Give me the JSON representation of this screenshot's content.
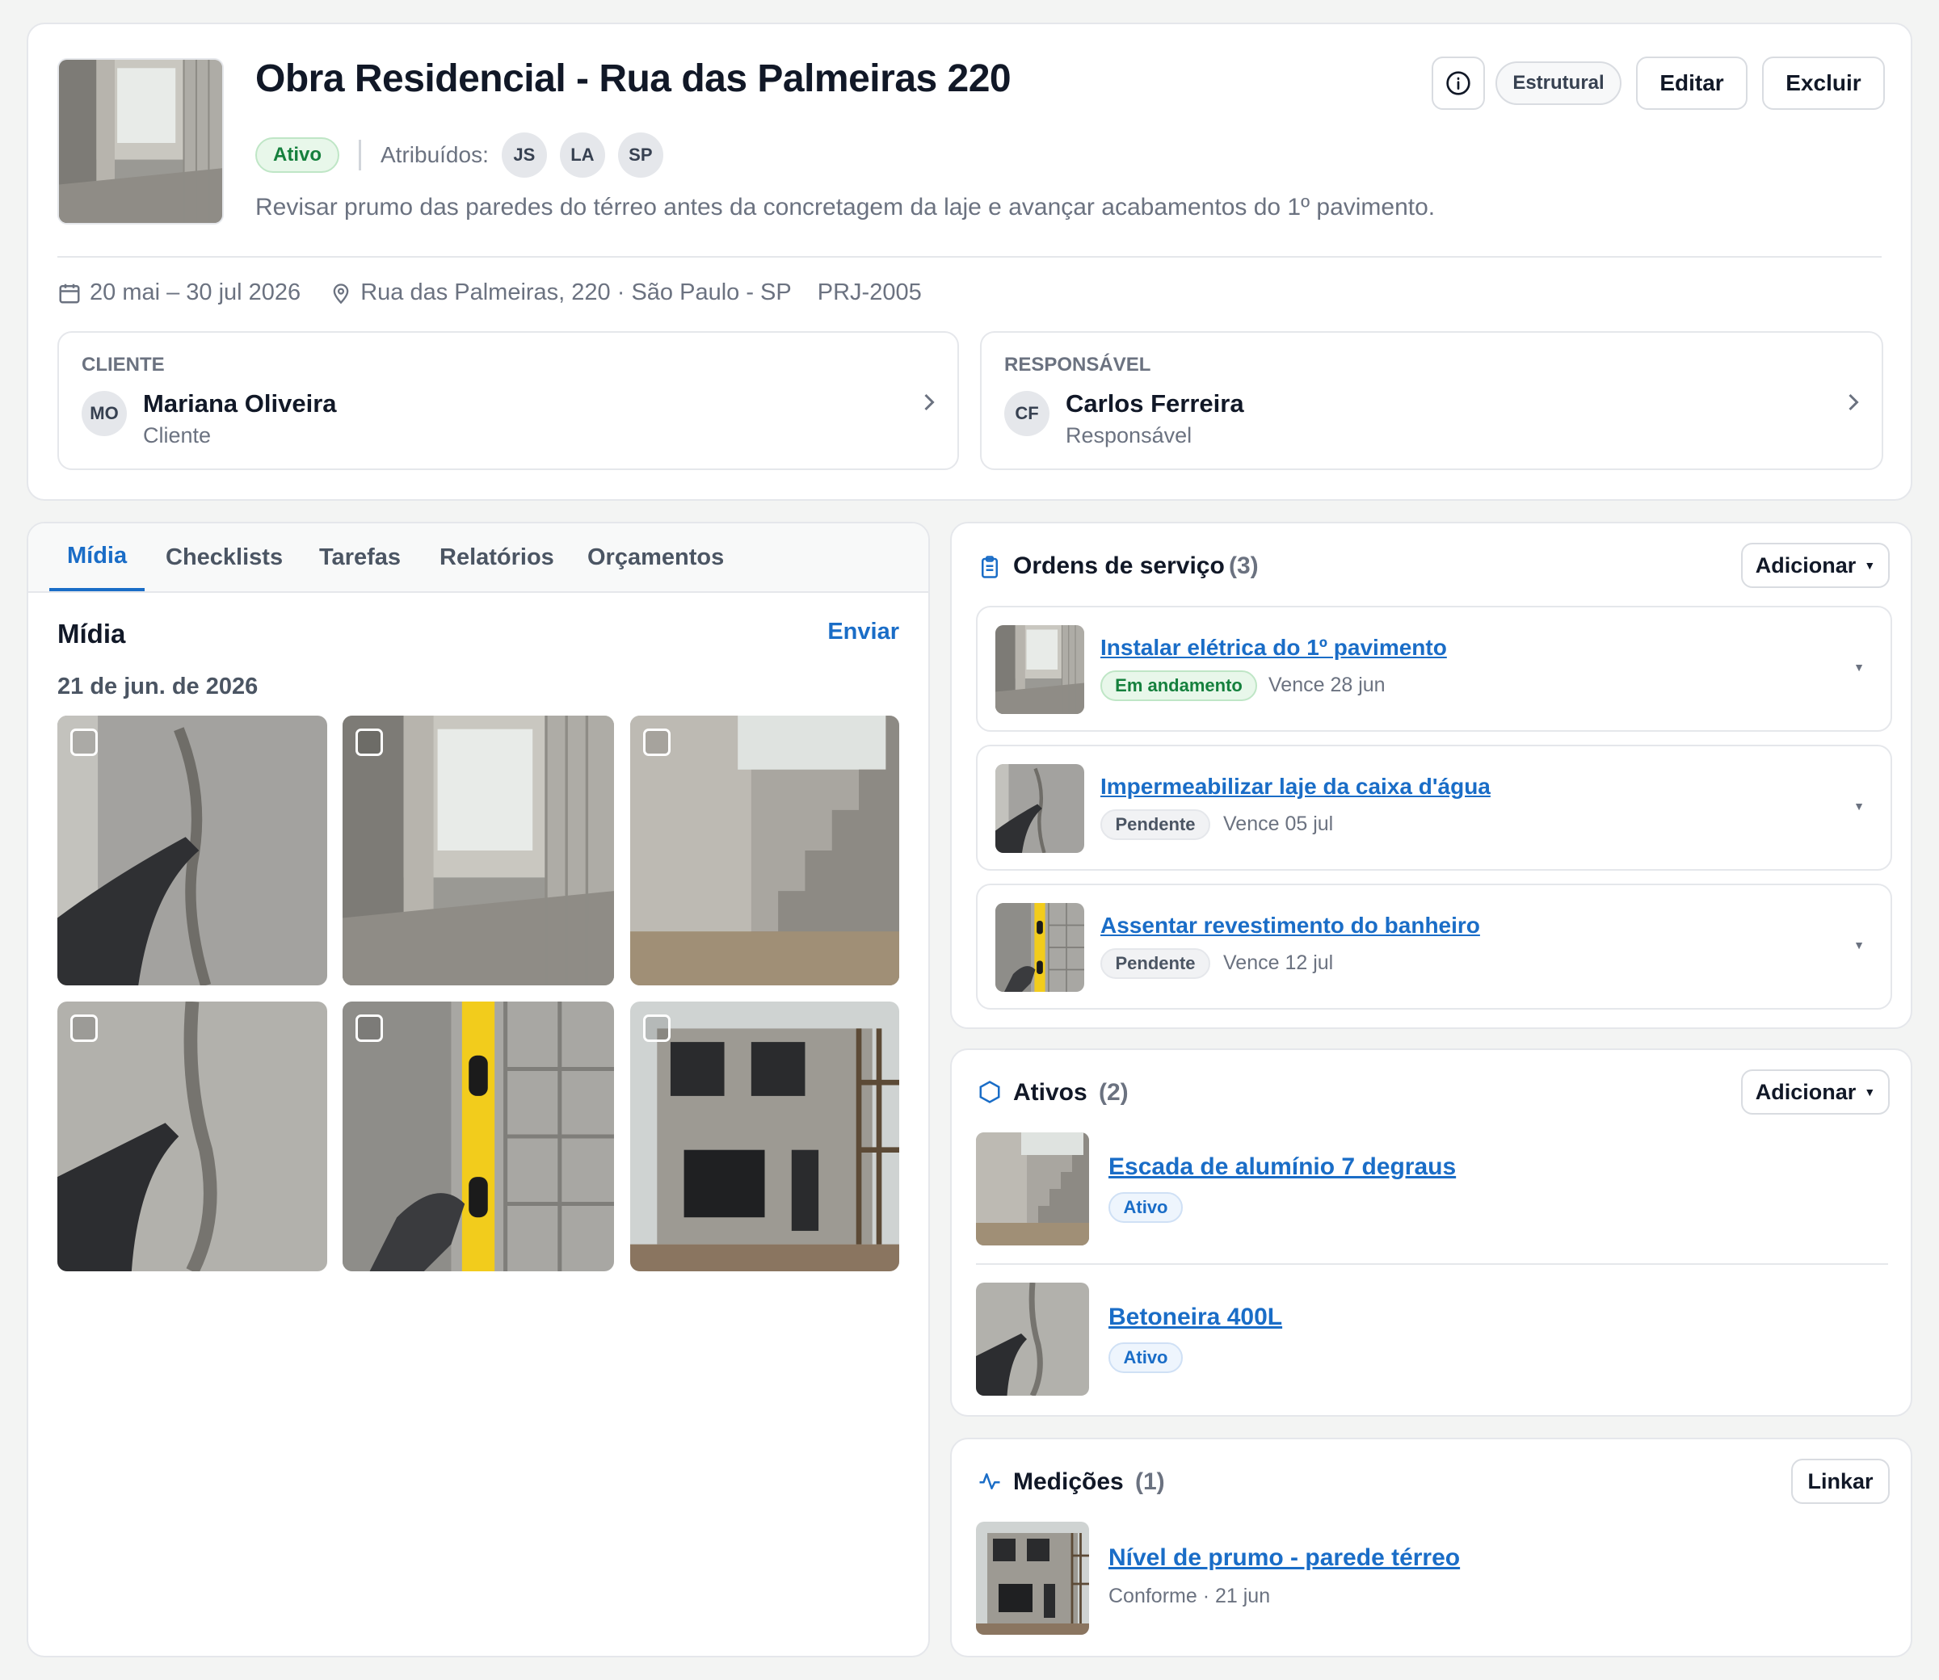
{
  "project": {
    "title": "Obra Residencial - Rua das Palmeiras 220",
    "status": "Ativo",
    "assigned_label": "Atribuídos:",
    "assignees": [
      "JS",
      "LA",
      "SP"
    ],
    "description": "Revisar prumo das paredes do térreo antes da concretagem da laje e avançar acabamentos do 1º pavimento.",
    "category": "Estrutural",
    "edit_label": "Editar",
    "delete_label": "Excluir",
    "dates": "20 mai – 30 jul 2026",
    "address": "Rua das Palmeiras, 220 · São Paulo - SP",
    "code": "PRJ-2005"
  },
  "client": {
    "heading": "CLIENTE",
    "initials": "MO",
    "name": "Mariana Oliveira",
    "role": "Cliente"
  },
  "manager": {
    "heading": "RESPONSÁVEL",
    "initials": "CF",
    "name": "Carlos Ferreira",
    "role": "Responsável"
  },
  "tabs": [
    "Mídia",
    "Checklists",
    "Tarefas",
    "Relatórios",
    "Orçamentos"
  ],
  "media": {
    "title": "Mídia",
    "send_label": "Enviar",
    "date": "21 de jun. de 2026"
  },
  "service_orders": {
    "title": "Ordens de serviço",
    "count": "(3)",
    "add_label": "Adicionar",
    "items": [
      {
        "title": "Instalar elétrica do 1º pavimento",
        "status": "Em andamento",
        "due": "Vence 28 jun"
      },
      {
        "title": "Impermeabilizar laje da caixa d'água",
        "status": "Pendente",
        "due": "Vence 05 jul"
      },
      {
        "title": "Assentar revestimento do banheiro",
        "status": "Pendente",
        "due": "Vence 12 jul"
      }
    ]
  },
  "assets": {
    "title": "Ativos",
    "count": "(2)",
    "add_label": "Adicionar",
    "items": [
      {
        "title": "Escada de alumínio 7 degraus",
        "status": "Ativo"
      },
      {
        "title": "Betoneira 400L",
        "status": "Ativo"
      }
    ]
  },
  "measurements": {
    "title": "Medições",
    "count": "(1)",
    "link_label": "Linkar",
    "items": [
      {
        "title": "Nível de prumo - parede térreo",
        "meta": "Conforme · 21 jun"
      }
    ]
  },
  "colors": {
    "accent": "#1a6dc7",
    "success": "#15803d",
    "border": "#e5e7eb"
  }
}
